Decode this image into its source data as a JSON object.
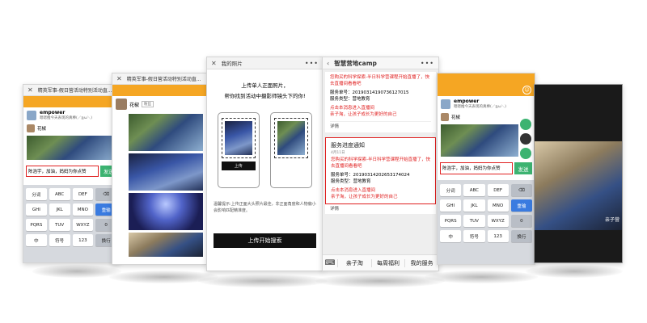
{
  "colors": {
    "accent_orange": "#f5a623",
    "send_green": "#3cb371",
    "alert_red": "#e02020",
    "enter_blue": "#3a7be0"
  },
  "chat_left": {
    "title": "精英军事-假日营活动特别活动直...",
    "account_name": "empower",
    "account_sub": "嗯嗯推今天表现的真棒(／≧ω＼)",
    "sender_name": "花椒",
    "input_text": "陈浩宇，加油，妈妈为你点赞",
    "send_label": "发送",
    "key_rows": [
      [
        "分词",
        "ABC",
        "DEF",
        "⌫"
      ],
      [
        "GHI",
        "JKL",
        "MNO",
        "重输"
      ],
      [
        "PQRS",
        "TUV",
        "WXYZ",
        "0"
      ],
      [
        "中",
        "符号",
        "123",
        "换行"
      ]
    ]
  },
  "photos_page": {
    "title": "精英军事-假日营活动特别活动直...",
    "user_name": "花椒",
    "user_badge": "粉丝"
  },
  "upload_page": {
    "title": "我的照片",
    "heading_line1": "上传单人正面照片，",
    "heading_line2": "帮你找到活动中摄影师镜头下的你!",
    "upload_label": "上传",
    "tip": "温馨提示:上传正面大头照片最佳，非正面角度和人物偏小会影响匹配精准度。",
    "button_label": "上传开始搜索"
  },
  "service_page": {
    "title": "智慧营地camp",
    "card_top": {
      "line1": "您购买的科学探索-半日科学营课程开始直播了，快去直播间看看吧",
      "order_label": "服务单号：",
      "order_no": "20190314190736127015",
      "type_label": "服务类型：",
      "type_value": "营地教育",
      "cta1": "点击本消息进入直播间",
      "cta2": "亲子淘，让孩子成长为更好的自己",
      "detail": "详情"
    },
    "card_main": {
      "heading": "服务进度通知",
      "date": "4月11日",
      "line1": "您购买的科学探索-半日科学营课程开始直播了，快去直播间看看吧",
      "order_label": "服务单号：",
      "order_no": "20190314202653174024",
      "type_label": "服务类型：",
      "type_value": "营地教育",
      "cta1": "点击本消息进入直播间",
      "cta2": "亲子淘，让孩子成长为更好的自己",
      "detail": "详情"
    },
    "tabs": [
      "亲子淘",
      "每周福利",
      "我的服务"
    ]
  },
  "chat_right": {
    "account_name": "empower",
    "account_sub": "嗯嗯推今天表现的真棒(／≧ω＼)",
    "sender_name": "花椒",
    "input_text": "陈浩宇，加油，妈妈为你点赞",
    "send_label": "发送",
    "key_rows": [
      [
        "分词",
        "ABC",
        "DEF",
        "⌫"
      ],
      [
        "GHI",
        "JKL",
        "MNO",
        "重输"
      ],
      [
        "PQRS",
        "TUV",
        "WXYZ",
        "0"
      ],
      [
        "中",
        "符号",
        "123",
        "换行"
      ]
    ]
  },
  "video_page": {
    "caption": "亲子营"
  }
}
